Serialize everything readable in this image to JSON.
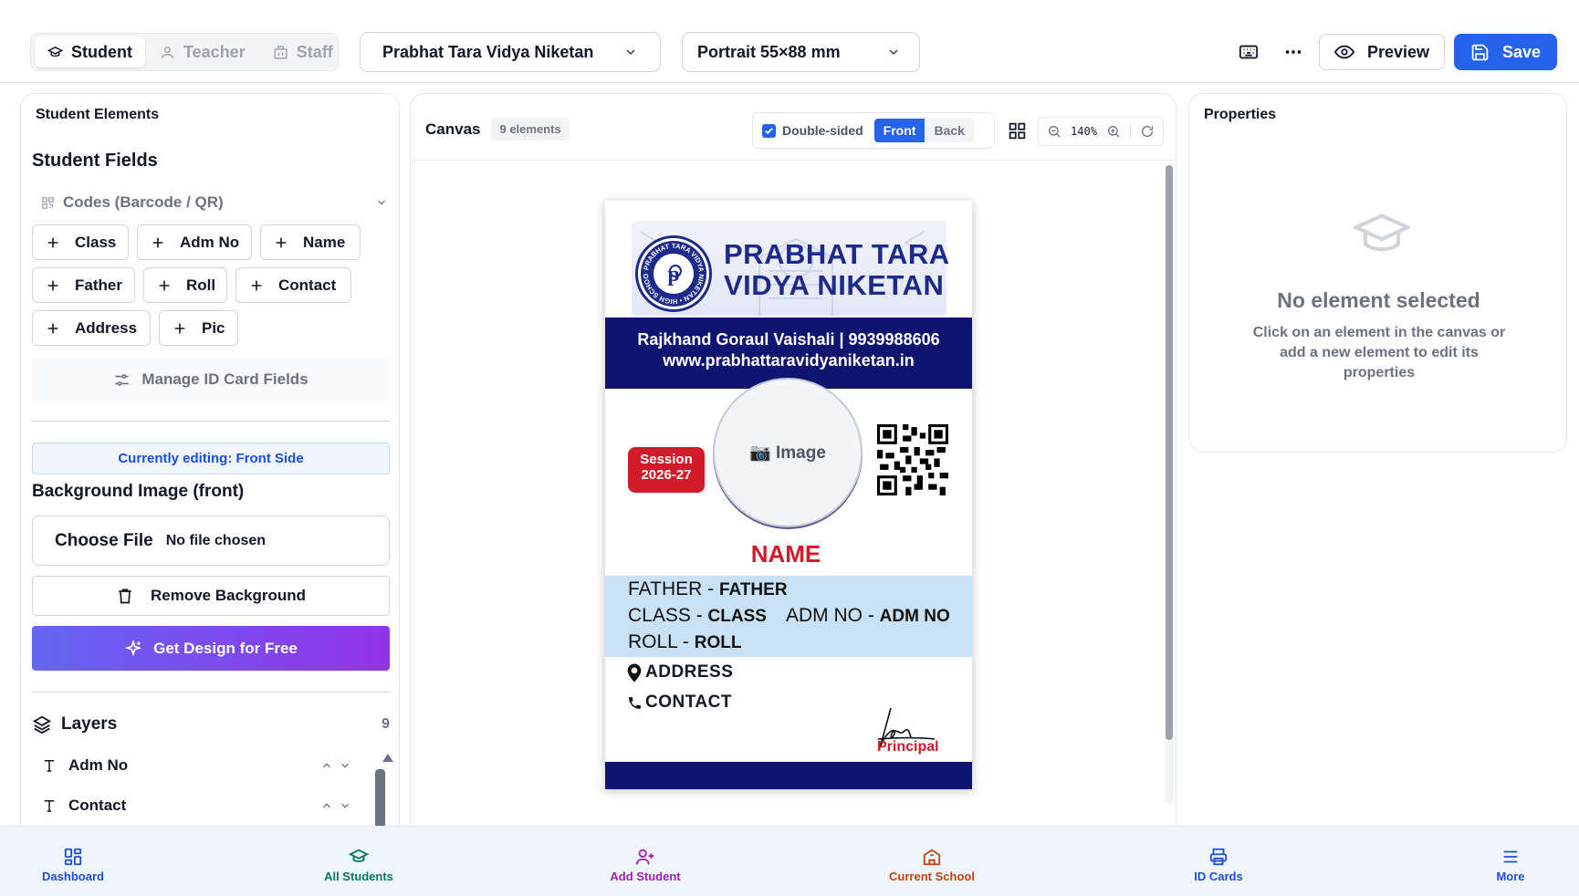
{
  "topbar": {
    "roles": [
      "Student",
      "Teacher",
      "Staff"
    ],
    "school_select": "Prabhat Tara Vidya Niketan",
    "layout_select": "Portrait 55×88 mm",
    "preview_label": "Preview",
    "save_label": "Save"
  },
  "left_panel": {
    "title": "Student Elements",
    "section_title": "Student Fields",
    "codes_label": "Codes (Barcode / QR)",
    "fields": [
      "Class",
      "Adm No",
      "Name",
      "Father",
      "Roll",
      "Contact",
      "Address",
      "Pic"
    ],
    "manage_label": "Manage ID Card Fields",
    "editing_notice": "Currently editing: Front Side",
    "bg_title": "Background Image (front)",
    "choose_file_label": "Choose File",
    "no_file_label": "No file chosen",
    "remove_bg_label": "Remove Background",
    "get_design_label": "Get Design for Free",
    "layers_title": "Layers",
    "layers_count": "9",
    "layers": [
      "Adm No",
      "Contact"
    ]
  },
  "canvas": {
    "title": "Canvas",
    "count_badge": "9 elements",
    "double_sided_label": "Double-sided",
    "double_sided_checked": true,
    "side_front": "Front",
    "side_back": "Back",
    "zoom": "140%"
  },
  "id_card": {
    "school_name_line1": "PRABHAT TARA",
    "school_name_line2": "VIDYA NIKETAN",
    "logo_ring_text": "PRABHAT TARA VIDYA NIKETAN",
    "logo_ring_bottom": "HIGH SCHOOL",
    "address_line": "Rajkhand Goraul Vaishali | 9939988606",
    "website_line": "www.prabhattaravidyaniketan.in",
    "session_label": "Session",
    "session_value": "2026-27",
    "image_placeholder": "📷 Image",
    "name": "NAME",
    "father_label": "FATHER - ",
    "father_value": "FATHER",
    "class_label": "CLASS - ",
    "class_value": "CLASS",
    "adm_label": "ADM NO - ",
    "adm_value": "ADM NO",
    "roll_label": "ROLL  - ",
    "roll_value": "ROLL",
    "address_value": "ADDRESS",
    "contact_value": "CONTACT",
    "principal_label": "Principal",
    "colors": {
      "navy": "#0f1470",
      "session_red": "#d11a2a",
      "name_red": "#d11a2a",
      "info_band": "#c9e1f5"
    }
  },
  "properties": {
    "title": "Properties",
    "empty_title": "No element selected",
    "empty_desc": "Click on an element in the canvas or add a new element to edit its properties"
  },
  "bottom_nav": [
    {
      "label": "Dashboard",
      "icon": "grid-icon",
      "color": "#1d4ed8"
    },
    {
      "label": "All Students",
      "icon": "graduation-cap-icon",
      "color": "#047857"
    },
    {
      "label": "Add Student",
      "icon": "user-plus-icon",
      "color": "#a21caf"
    },
    {
      "label": "Current School",
      "icon": "school-icon",
      "color": "#c2410c"
    },
    {
      "label": "ID Cards",
      "icon": "printer-icon",
      "color": "#1d4ed8"
    },
    {
      "label": "More",
      "icon": "menu-icon",
      "color": "#1d4ed8"
    }
  ]
}
